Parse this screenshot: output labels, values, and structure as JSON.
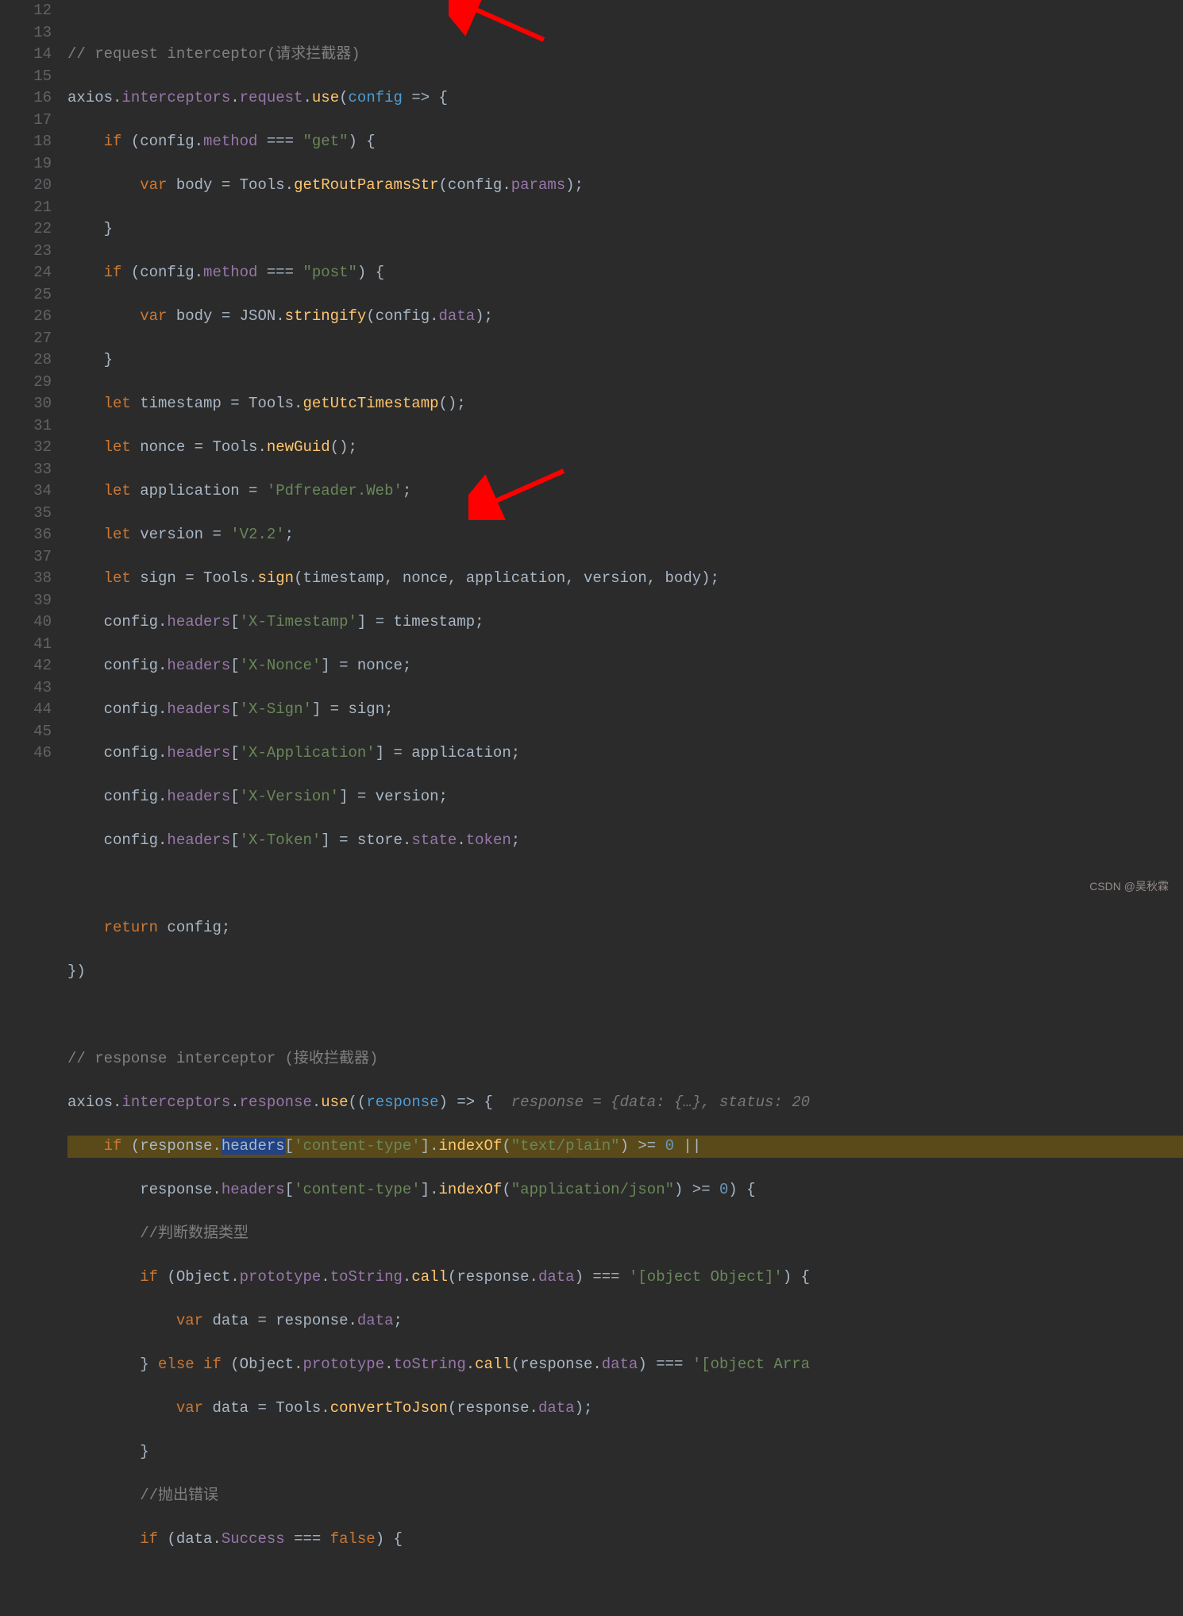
{
  "gutter": {
    "start": 12,
    "end": 46
  },
  "lines": {
    "l12": {
      "cm": "// request interceptor(请求拦截器)"
    },
    "l13": {
      "a": "axios.",
      "b": "interceptors",
      "c": ".",
      "d": "request",
      "e": ".",
      "f": "use",
      "g": "(",
      "h": "config",
      "i": " => {"
    },
    "l14": {
      "a": "    ",
      "b": "if",
      "c": " (config.",
      "d": "method",
      "e": " === ",
      "f": "\"get\"",
      "g": ") {"
    },
    "l15": {
      "a": "        ",
      "b": "var",
      "c": " body = Tools.",
      "d": "getRoutParamsStr",
      "e": "(config.",
      "f": "params",
      "g": ");"
    },
    "l16": {
      "a": "    }"
    },
    "l17": {
      "a": "    ",
      "b": "if",
      "c": " (config.",
      "d": "method",
      "e": " === ",
      "f": "\"post\"",
      "g": ") {"
    },
    "l18": {
      "a": "        ",
      "b": "var",
      "c": " body = JSON.",
      "d": "stringify",
      "e": "(config.",
      "f": "data",
      "g": ");"
    },
    "l19": {
      "a": "    }"
    },
    "l20": {
      "a": "    ",
      "b": "let",
      "c": " timestamp = Tools.",
      "d": "getUtcTimestamp",
      "e": "();"
    },
    "l21": {
      "a": "    ",
      "b": "let",
      "c": " nonce = Tools.",
      "d": "newGuid",
      "e": "();"
    },
    "l22": {
      "a": "    ",
      "b": "let",
      "c": " application = ",
      "d": "'Pdfreader.Web'",
      "e": ";"
    },
    "l23": {
      "a": "    ",
      "b": "let",
      "c": " version = ",
      "d": "'V2.2'",
      "e": ";"
    },
    "l24": {
      "a": "    ",
      "b": "let",
      "c": " sign = Tools.",
      "d": "sign",
      "e": "(timestamp, nonce, application, version, body);"
    },
    "l25": {
      "a": "    config.",
      "b": "headers",
      "c": "[",
      "d": "'X-Timestamp'",
      "e": "] = timestamp;"
    },
    "l26": {
      "a": "    config.",
      "b": "headers",
      "c": "[",
      "d": "'X-Nonce'",
      "e": "] = nonce;"
    },
    "l27": {
      "a": "    config.",
      "b": "headers",
      "c": "[",
      "d": "'X-Sign'",
      "e": "] = sign;"
    },
    "l28": {
      "a": "    config.",
      "b": "headers",
      "c": "[",
      "d": "'X-Application'",
      "e": "] = application;"
    },
    "l29": {
      "a": "    config.",
      "b": "headers",
      "c": "[",
      "d": "'X-Version'",
      "e": "] = version;"
    },
    "l30": {
      "a": "    config.",
      "b": "headers",
      "c": "[",
      "d": "'X-Token'",
      "e": "] = store.",
      "f": "state",
      "g": ".",
      "h": "token",
      "i": ";"
    },
    "l31": {
      "a": ""
    },
    "l32": {
      "a": "    ",
      "b": "return",
      "c": " config;"
    },
    "l33": {
      "a": "})"
    },
    "l34": {
      "a": ""
    },
    "l35": {
      "cm": "// response interceptor (接收拦截器)"
    },
    "l36": {
      "a": "axios.",
      "b": "interceptors",
      "c": ".",
      "d": "response",
      "e": ".",
      "f": "use",
      "g": "((",
      "h": "response",
      "i": ") => {  ",
      "hint": "response = {data: {…}, status: 20"
    },
    "l37": {
      "a": "    ",
      "b": "if",
      "c": " (response.",
      "sel": "headers",
      "d": "[",
      "e": "'content-type'",
      "f": "].",
      "g": "indexOf",
      "h": "(",
      "i": "\"text/plain\"",
      "j": ") >= ",
      "k": "0",
      "l": " ||"
    },
    "l38": {
      "a": "        response.",
      "b": "headers",
      "c": "[",
      "d": "'content-type'",
      "e": "].",
      "f": "indexOf",
      "g": "(",
      "h": "\"application/json\"",
      "i": ") >= ",
      "j": "0",
      "k": ") {"
    },
    "l39": {
      "a": "        ",
      "cm": "//判断数据类型"
    },
    "l40": {
      "a": "        ",
      "b": "if",
      "c": " (Object.",
      "d": "prototype",
      "e": ".",
      "f": "toString",
      "g": ".",
      "h": "call",
      "i": "(response.",
      "j": "data",
      "k": ") === ",
      "l": "'[object Object]'",
      "m": ") {"
    },
    "l41": {
      "a": "            ",
      "b": "var",
      "c": " data = response.",
      "d": "data",
      "e": ";"
    },
    "l42": {
      "a": "        } ",
      "b": "else if",
      "c": " (Object.",
      "d": "prototype",
      "e": ".",
      "f": "toString",
      "g": ".",
      "h": "call",
      "i": "(response.",
      "j": "data",
      "k": ") === ",
      "l": "'[object Arra"
    },
    "l43": {
      "a": "            ",
      "b": "var",
      "c": " data = Tools.",
      "d": "convertToJson",
      "e": "(response.",
      "f": "data",
      "g": ");"
    },
    "l44": {
      "a": "        }"
    },
    "l45": {
      "a": "        ",
      "cm": "//抛出错误"
    },
    "l46": {
      "a": "        ",
      "b": "if",
      "c": " (data.",
      "d": "Success",
      "e": " === ",
      "f": "false",
      "g": ") {"
    }
  },
  "watermark": "CSDN @吴秋霖"
}
